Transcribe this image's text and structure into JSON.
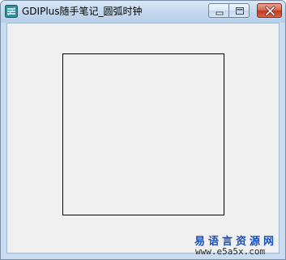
{
  "window": {
    "title": "GDIPlus随手笔记_圆弧时钟",
    "icon": "app-icon"
  },
  "controls": {
    "minimize_icon": "minimize-icon",
    "maximize_icon": "maximize-icon",
    "close_icon": "close-icon"
  },
  "watermark": {
    "cn": "易语言资源网",
    "url": "www.e5a5x.com"
  },
  "colors": {
    "client_bg": "#f0f0f0",
    "frame_border": "#000000",
    "watermark": "#1a4fb8",
    "close_button": "#c2381c"
  }
}
